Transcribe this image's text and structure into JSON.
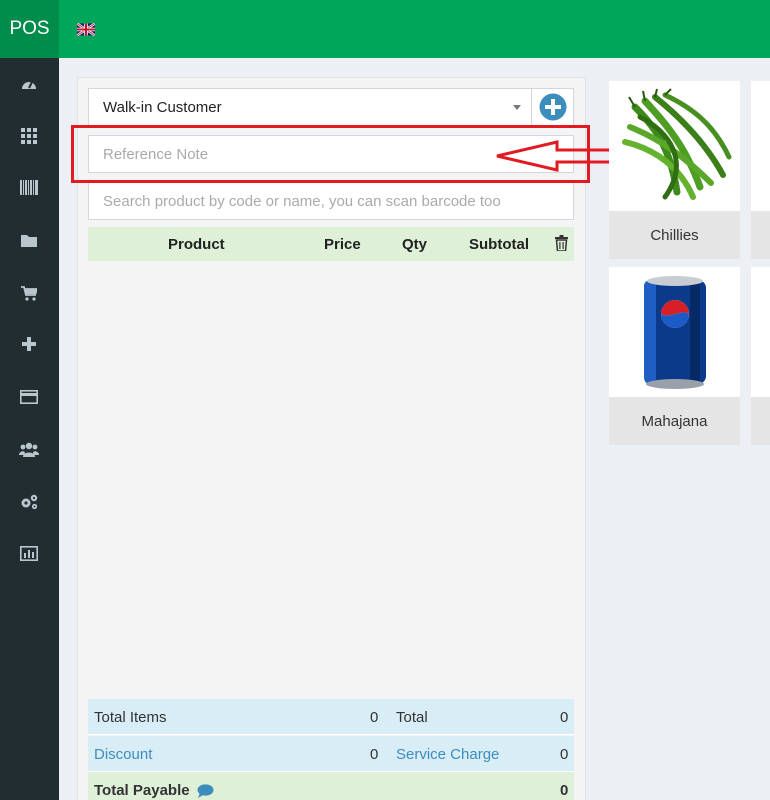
{
  "header": {
    "brand": "POS",
    "language_icon": "uk-flag-icon"
  },
  "sidebar": {
    "items": [
      {
        "icon": "dashboard-icon"
      },
      {
        "icon": "grid-icon"
      },
      {
        "icon": "barcode-icon"
      },
      {
        "icon": "folder-icon"
      },
      {
        "icon": "cart-icon"
      },
      {
        "icon": "plus-icon"
      },
      {
        "icon": "credit-card-icon"
      },
      {
        "icon": "users-icon"
      },
      {
        "icon": "settings-icon"
      },
      {
        "icon": "bar-chart-icon"
      }
    ]
  },
  "pos": {
    "customer": "Walk-in Customer",
    "reference_placeholder": "Reference Note",
    "search_placeholder": "Search product by code or name, you can scan barcode too",
    "table": {
      "headers": {
        "product": "Product",
        "price": "Price",
        "qty": "Qty",
        "subtotal": "Subtotal"
      }
    },
    "totals": {
      "total_items_label": "Total Items",
      "total_items": "0",
      "total_label": "Total",
      "total": "0",
      "discount_label": "Discount",
      "discount": "0",
      "service_charge_label": "Service Charge",
      "service_charge": "0",
      "payable_label": "Total Payable",
      "payable": "0"
    }
  },
  "products": [
    {
      "name": "Chillies"
    },
    {
      "name": "Mahajana"
    }
  ],
  "colors": {
    "header": "#00a65a",
    "brand": "#008d4c",
    "sidebar": "#222d32",
    "highlight": "#e21b23",
    "link": "#3c8dbc"
  }
}
